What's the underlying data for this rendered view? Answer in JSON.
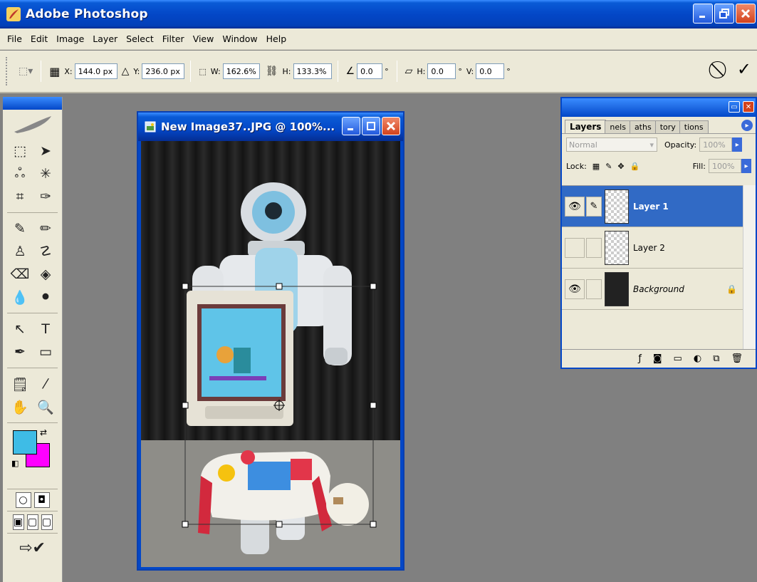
{
  "app": {
    "title": "Adobe Photoshop",
    "window_buttons": [
      "_",
      "⧉",
      "X"
    ]
  },
  "menu": [
    "File",
    "Edit",
    "Image",
    "Layer",
    "Select",
    "Filter",
    "View",
    "Window",
    "Help"
  ],
  "options": {
    "x_label": "X:",
    "x_value": "144.0 px",
    "y_label": "Y:",
    "y_value": "236.0 px",
    "w_label": "W:",
    "w_value": "162.6%",
    "h_label": "H:",
    "h_value": "133.3%",
    "angle_value": "0.0",
    "deg": "°",
    "skew_h_label": "H:",
    "skew_h_value": "0.0",
    "skew_v_label": "V:",
    "skew_v_value": "0.0"
  },
  "document": {
    "title": "New Image37..JPG @ 100%..."
  },
  "colors": {
    "foreground": "#3ebce6",
    "background": "#ff00ff",
    "title_blue": "#0347c7",
    "selection_blue": "#316ac5"
  },
  "layers_panel": {
    "tabs": [
      "Layers",
      "nels",
      "aths",
      "tory",
      "tions"
    ],
    "blend_mode": "Normal",
    "opacity_label": "Opacity:",
    "opacity_value": "100%",
    "lock_label": "Lock:",
    "fill_label": "Fill:",
    "fill_value": "100%",
    "layers": [
      {
        "name": "Layer 1",
        "visible": true,
        "selected": true
      },
      {
        "name": "Layer 2",
        "visible": false,
        "selected": false
      },
      {
        "name": "Background",
        "visible": true,
        "selected": false,
        "locked": true
      }
    ]
  }
}
